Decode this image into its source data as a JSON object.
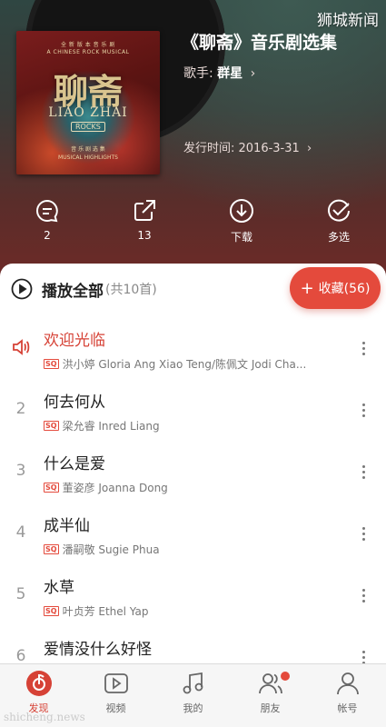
{
  "header": {
    "watermark": "狮城新闻",
    "album_title": "《聊斋》音乐剧选集",
    "singer_label": "歌手:",
    "singer_name": "群星",
    "release_label": "发行时间: 2016-3-31",
    "cover": {
      "sub_cn": "全 新 版 本 音 乐 剧",
      "sub_en": "A CHINESE ROCK MUSICAL",
      "title": "聊斋",
      "title_en": "LIAO ZHAI",
      "rocks": "ROCKS",
      "bottom_cn": "音 乐 剧 选 集",
      "bottom_en": "MUSICAL HIGHLIGHTS"
    },
    "actions": [
      {
        "icon": "comment-icon",
        "label": "2"
      },
      {
        "icon": "share-icon",
        "label": "13"
      },
      {
        "icon": "download-icon",
        "label": "下载"
      },
      {
        "icon": "multiselect-icon",
        "label": "多选"
      }
    ]
  },
  "list": {
    "play_all": "播放全部",
    "count": "(共10首)",
    "collect_plus": "+",
    "collect_label": "收藏(56)",
    "sq": "SQ",
    "songs": [
      {
        "index": "",
        "title": "欢迎光临",
        "artist": "洪小婷 Gloria Ang Xiao Teng/陈佩文 Jodi Cha...",
        "playing": true
      },
      {
        "index": "2",
        "title": "何去何从",
        "artist": "梁允睿 Inred Liang"
      },
      {
        "index": "3",
        "title": "什么是爱",
        "artist": "董姿彦 Joanna Dong"
      },
      {
        "index": "4",
        "title": "成半仙",
        "artist": "潘嗣敬 Sugie Phua"
      },
      {
        "index": "5",
        "title": "水草",
        "artist": "叶贞芳 Ethel Yap"
      },
      {
        "index": "6",
        "title": "爱情没什么好怪",
        "artist": ""
      }
    ]
  },
  "tabbar": {
    "tabs": [
      {
        "label": "发现",
        "icon": "discover-icon",
        "active": true
      },
      {
        "label": "视频",
        "icon": "video-icon"
      },
      {
        "label": "我的",
        "icon": "music-icon"
      },
      {
        "label": "朋友",
        "icon": "friends-icon",
        "badge": true
      },
      {
        "label": "帐号",
        "icon": "account-icon"
      }
    ]
  },
  "footer_watermark": "shicheng.news",
  "colors": {
    "accent": "#e44a3c",
    "playing": "#d64236"
  }
}
